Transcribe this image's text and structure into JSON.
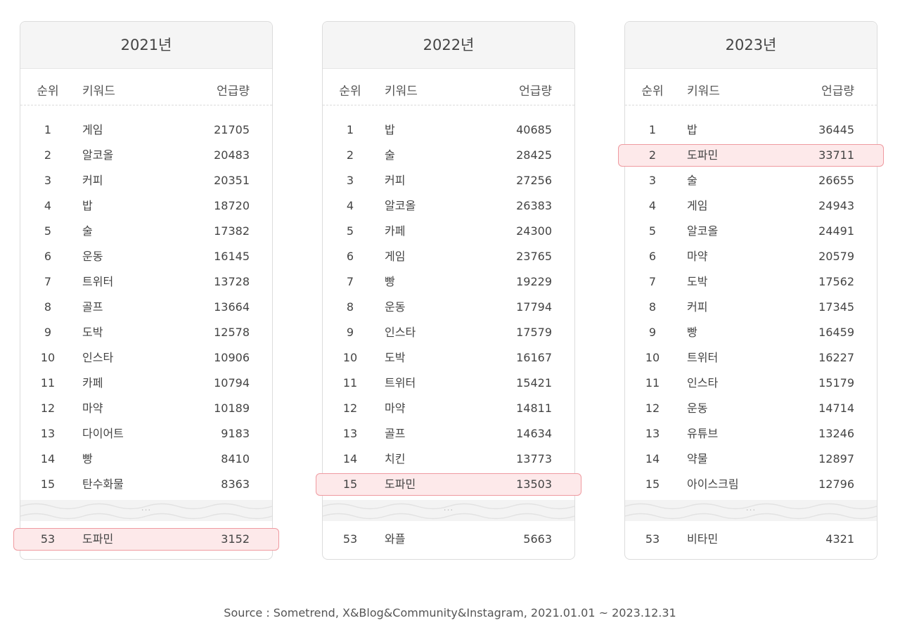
{
  "header": {
    "rank": "순위",
    "keyword": "키워드",
    "count": "언급량"
  },
  "ellipsis": "...",
  "tables": [
    {
      "year": "2021년",
      "rows": [
        {
          "rank": "1",
          "keyword": "게임",
          "count": "21705"
        },
        {
          "rank": "2",
          "keyword": "알코올",
          "count": "20483"
        },
        {
          "rank": "3",
          "keyword": "커피",
          "count": "20351"
        },
        {
          "rank": "4",
          "keyword": "밥",
          "count": "18720"
        },
        {
          "rank": "5",
          "keyword": "술",
          "count": "17382"
        },
        {
          "rank": "6",
          "keyword": "운동",
          "count": "16145"
        },
        {
          "rank": "7",
          "keyword": "트위터",
          "count": "13728"
        },
        {
          "rank": "8",
          "keyword": "골프",
          "count": "13664"
        },
        {
          "rank": "9",
          "keyword": "도박",
          "count": "12578"
        },
        {
          "rank": "10",
          "keyword": "인스타",
          "count": "10906"
        },
        {
          "rank": "11",
          "keyword": "카페",
          "count": "10794"
        },
        {
          "rank": "12",
          "keyword": "마약",
          "count": "10189"
        },
        {
          "rank": "13",
          "keyword": "다이어트",
          "count": "9183"
        },
        {
          "rank": "14",
          "keyword": "빵",
          "count": "8410"
        },
        {
          "rank": "15",
          "keyword": "탄수화물",
          "count": "8363"
        }
      ],
      "highlight_index": -1,
      "last": {
        "rank": "53",
        "keyword": "도파민",
        "count": "3152",
        "highlighted": true
      }
    },
    {
      "year": "2022년",
      "rows": [
        {
          "rank": "1",
          "keyword": "밥",
          "count": "40685"
        },
        {
          "rank": "2",
          "keyword": "술",
          "count": "28425"
        },
        {
          "rank": "3",
          "keyword": "커피",
          "count": "27256"
        },
        {
          "rank": "4",
          "keyword": "알코올",
          "count": "26383"
        },
        {
          "rank": "5",
          "keyword": "카페",
          "count": "24300"
        },
        {
          "rank": "6",
          "keyword": "게임",
          "count": "23765"
        },
        {
          "rank": "7",
          "keyword": "빵",
          "count": "19229"
        },
        {
          "rank": "8",
          "keyword": "운동",
          "count": "17794"
        },
        {
          "rank": "9",
          "keyword": "인스타",
          "count": "17579"
        },
        {
          "rank": "10",
          "keyword": "도박",
          "count": "16167"
        },
        {
          "rank": "11",
          "keyword": "트위터",
          "count": "15421"
        },
        {
          "rank": "12",
          "keyword": "마약",
          "count": "14811"
        },
        {
          "rank": "13",
          "keyword": "골프",
          "count": "14634"
        },
        {
          "rank": "14",
          "keyword": "치킨",
          "count": "13773"
        },
        {
          "rank": "15",
          "keyword": "도파민",
          "count": "13503"
        }
      ],
      "highlight_index": 14,
      "last": {
        "rank": "53",
        "keyword": "와플",
        "count": "5663",
        "highlighted": false
      }
    },
    {
      "year": "2023년",
      "rows": [
        {
          "rank": "1",
          "keyword": "밥",
          "count": "36445"
        },
        {
          "rank": "2",
          "keyword": "도파민",
          "count": "33711"
        },
        {
          "rank": "3",
          "keyword": "술",
          "count": "26655"
        },
        {
          "rank": "4",
          "keyword": "게임",
          "count": "24943"
        },
        {
          "rank": "5",
          "keyword": "알코올",
          "count": "24491"
        },
        {
          "rank": "6",
          "keyword": "마약",
          "count": "20579"
        },
        {
          "rank": "7",
          "keyword": "도박",
          "count": "17562"
        },
        {
          "rank": "8",
          "keyword": "커피",
          "count": "17345"
        },
        {
          "rank": "9",
          "keyword": "빵",
          "count": "16459"
        },
        {
          "rank": "10",
          "keyword": "트위터",
          "count": "16227"
        },
        {
          "rank": "11",
          "keyword": "인스타",
          "count": "15179"
        },
        {
          "rank": "12",
          "keyword": "운동",
          "count": "14714"
        },
        {
          "rank": "13",
          "keyword": "유튜브",
          "count": "13246"
        },
        {
          "rank": "14",
          "keyword": "약물",
          "count": "12897"
        },
        {
          "rank": "15",
          "keyword": "아이스크림",
          "count": "12796"
        }
      ],
      "highlight_index": 1,
      "last": {
        "rank": "53",
        "keyword": "비타민",
        "count": "4321",
        "highlighted": false
      }
    }
  ],
  "colors": {
    "highlight_fill": "#fde9ea",
    "highlight_border": "#ef9aa0",
    "header_bg": "#f5f5f5"
  },
  "source": "Source : Sometrend, X&Blog&Community&Instagram, 2021.01.01 ~ 2023.12.31"
}
